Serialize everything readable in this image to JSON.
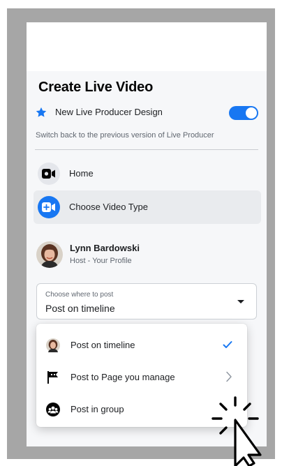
{
  "page": {
    "title": "Create Live Video"
  },
  "design_toggle": {
    "label": "New Live Producer Design",
    "enabled": true
  },
  "switch_back": {
    "label": "Switch back to the previous version of Live Producer"
  },
  "nav": {
    "items": [
      {
        "label": "Home",
        "icon": "live-video-icon",
        "active": false
      },
      {
        "label": "Choose Video Type",
        "icon": "video-camera-icon",
        "active": true
      }
    ]
  },
  "host": {
    "name": "Lynn Bardowski",
    "role": "Host - Your Profile"
  },
  "post_select": {
    "caption": "Choose where to post",
    "value": "Post on timeline"
  },
  "dropdown": {
    "options": [
      {
        "label": "Post on timeline",
        "icon": "profile-avatar-icon",
        "selected": true
      },
      {
        "label": "Post to Page you manage",
        "icon": "flag-icon",
        "has_submenu": true
      },
      {
        "label": "Post in group",
        "icon": "group-icon"
      }
    ]
  },
  "colors": {
    "accent": "#1877f2",
    "frame": "#a6a6a6",
    "panel": "#f6f7f9",
    "active_item": "#e9ebee"
  }
}
